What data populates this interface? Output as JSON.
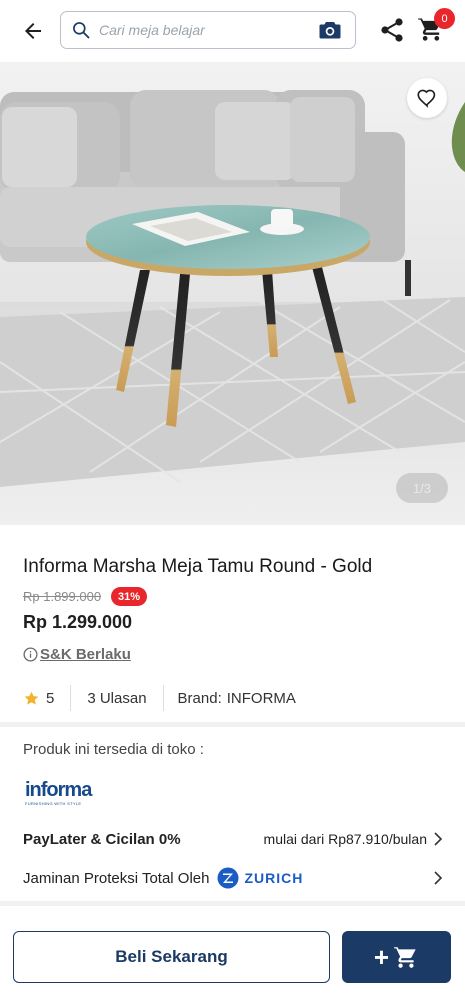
{
  "header": {
    "back_icon": "arrow-left-icon",
    "search_placeholder": "Cari meja belajar",
    "search_icon": "search-icon",
    "camera_icon": "camera-icon",
    "share_icon": "share-icon",
    "cart_icon": "cart-icon",
    "cart_count": "0"
  },
  "gallery": {
    "counter": "1/3",
    "favorite_icon": "heart-outline-icon"
  },
  "product": {
    "title": "Informa Marsha Meja Tamu Round - Gold",
    "old_price": "Rp 1.899.000",
    "discount": "31%",
    "price": "Rp 1.299.000",
    "terms_label": "S&K Berlaku",
    "rating": "5",
    "reviews": "3 Ulasan",
    "brand_label": "Brand:",
    "brand_value": "INFORMA"
  },
  "availability": {
    "label": "Produk ini tersedia di toko :",
    "store_logo_text": "informa",
    "store_logo_tagline": "FURNISHING WITH STYLE"
  },
  "paylater": {
    "label": "PayLater & Cicilan 0%",
    "value": "mulai dari Rp87.910/bulan"
  },
  "protection": {
    "label": "Jaminan Proteksi Total Oleh",
    "partner": "ZURICH"
  },
  "actions": {
    "buy_now": "Beli Sekarang",
    "add_to_cart_plus": "+"
  },
  "colors": {
    "primary": "#1b3a66",
    "discount_red": "#e8262b",
    "zurich_blue": "#1b5cc4"
  }
}
